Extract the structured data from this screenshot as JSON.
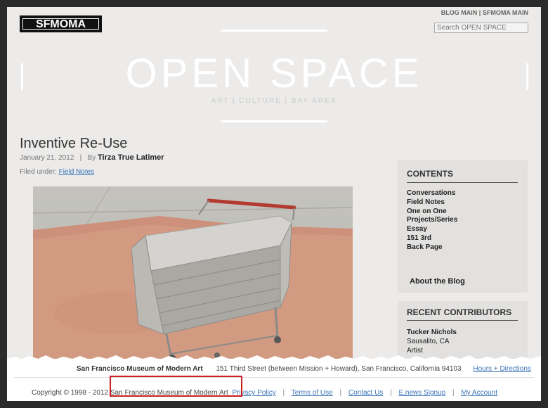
{
  "logo": {
    "text": "SFMOMA"
  },
  "top_nav": {
    "blog_main": "BLOG MAIN",
    "separator": "|",
    "sfmoma_main": "SFMOMA MAIN"
  },
  "search": {
    "placeholder": "Search OPEN SPACE"
  },
  "masthead": {
    "title": "OPEN SPACE",
    "tagline": "ART | CULTURE | BAY AREA"
  },
  "post": {
    "title": "Inventive Re-Use",
    "date": "January 21, 2012",
    "by_sep": "|",
    "by_label": "By",
    "author": "Tirza True Latimer",
    "filed_label": "Filed under:",
    "category": "Field Notes"
  },
  "sidebar": {
    "contents_heading": "CONTENTS",
    "contents": [
      "Conversations",
      "Field Notes",
      "One on One",
      "Projects/Series",
      "Essay",
      "151 3rd",
      "Back Page"
    ],
    "about": "About the Blog",
    "contributors_heading": "RECENT CONTRIBUTORS",
    "contributor": {
      "name": "Tucker Nichols",
      "location": "Sausalito, CA",
      "role": "Artist"
    }
  },
  "footer": {
    "museum": "San Francisco Museum of Modern Art",
    "address": "151 Third Street (between Mission + Howard), San Francisco, California 94103",
    "hours_link": "Hours + Directions",
    "copyright": "Copyright © 1998 - 2012 San Francisco Museum of Modern Art",
    "links": [
      "Privacy Policy",
      "Terms of Use",
      "Contact Us",
      "E.news Signup",
      "My Account"
    ],
    "separator": "|"
  },
  "colors": {
    "background": "#ecebea",
    "link": "#3a74b8",
    "highlight": "#cc1f1f",
    "sidebar_box": "#e2e1e0"
  }
}
